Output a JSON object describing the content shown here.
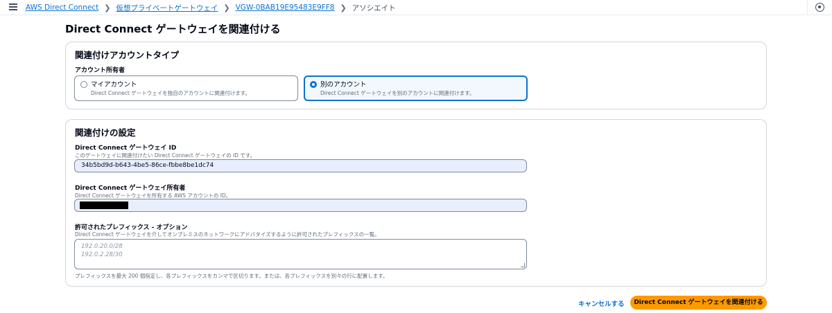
{
  "breadcrumbs": {
    "items": [
      "AWS Direct Connect",
      "仮想プライベートゲートウェイ",
      "VGW-0BAB19E95483E9FF8"
    ],
    "current": "アソシエイト"
  },
  "page": {
    "title": "Direct Connect ゲートウェイを関連付ける"
  },
  "account_type": {
    "title": "関連付けアカウントタイプ",
    "owner_label": "アカウント所有者",
    "options": [
      {
        "label": "マイアカウント",
        "desc": "Direct Connect ゲートウェイを独自のアカウントに関連付けます。",
        "selected": false
      },
      {
        "label": "別のアカウント",
        "desc": "Direct Connect ゲートウェイを別のアカウントに関連付けます。",
        "selected": true
      }
    ]
  },
  "settings": {
    "title": "関連付けの設定",
    "gateway_id": {
      "label": "Direct Connect ゲートウェイ ID",
      "desc": "このゲートウェイに関連付けたい Direct Connect ゲートウェイの ID です。",
      "value": "34b5bd9d-b643-4be5-86ce-fbbe8be1dc74"
    },
    "gateway_owner": {
      "label": "Direct Connect ゲートウェイ所有者",
      "desc": "Direct Connect ゲートウェイを所有する AWS アカウントの ID。"
    },
    "prefixes": {
      "label": "許可されたプレフィックス - オプション",
      "desc": "Direct Connect ゲートウェイを介してオンプレミスのネットワークにアドバタイズするように許可されたプレフィックスの一覧。",
      "placeholder_lines": [
        "192.0.20.0/28",
        "192.0.2.28/30"
      ],
      "hint": "プレフィックスを最大 200 個指定し、各プレフィックスをカンマで区切ります。または、各プレフィックスを別々の行に配置します。"
    }
  },
  "actions": {
    "cancel": "キャンセルする",
    "submit": "Direct Connect ゲートウェイを関連付ける"
  },
  "colors": {
    "accent": "#0972d3",
    "primary_button": "#ff9900",
    "input_fill": "#e8eefc"
  },
  "icons": {
    "menu": "hamburger-icon",
    "breadcrumb_separator": "chevron-right-icon",
    "help": "info-icon"
  }
}
